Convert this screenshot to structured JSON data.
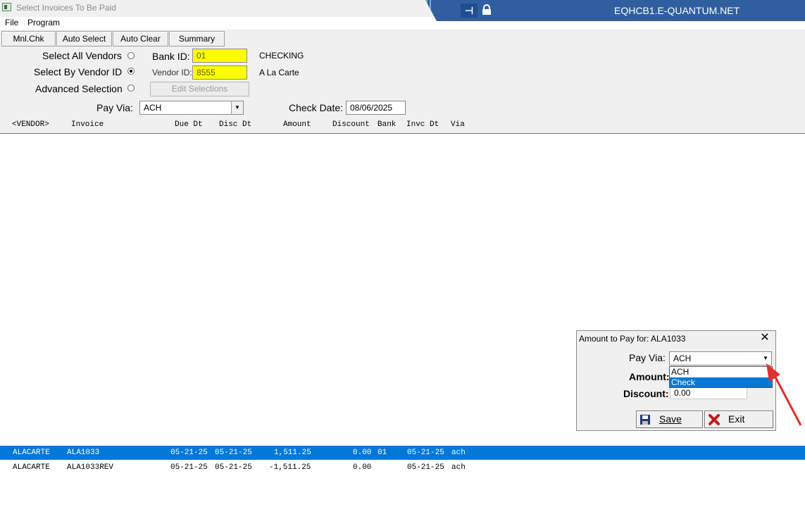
{
  "window": {
    "title": "Select Invoices To Be Paid",
    "server": "EQHCB1.E-QUANTUM.NET",
    "banner_color": "#2f5f9e"
  },
  "menu": {
    "file": "File",
    "program": "Program"
  },
  "toolbar": {
    "manual_check": "Mnl.Chk",
    "auto_select": "Auto Select",
    "auto_clear": "Auto Clear",
    "summary": "Summary"
  },
  "form": {
    "select_all_vendors": "Select All Vendors",
    "select_by_vendor_id": "Select By Vendor ID",
    "advanced_selection": "Advanced Selection",
    "selected_mode": "select_by_vendor_id",
    "bank_id_label": "Bank ID:",
    "bank_id_value": "01",
    "bank_name": "CHECKING",
    "vendor_id_label": "Vendor ID:",
    "vendor_id_value": "8555",
    "vendor_name": "A La Carte",
    "edit_selections": "Edit Selections",
    "pay_via_label": "Pay Via:",
    "pay_via_value": "ACH",
    "check_date_label": "Check Date:",
    "check_date_value": "08/06/2025",
    "field_highlight_color": "#ffff00"
  },
  "columns": {
    "vendor": "<VENDOR>",
    "invoice": "Invoice",
    "due_dt": "Due Dt",
    "disc_dt": "Disc Dt",
    "amount": "Amount",
    "discount": "Discount",
    "bank": "Bank",
    "invc_dt": "Invc Dt",
    "via": "Via"
  },
  "rows": [
    {
      "vendor": "ALACARTE",
      "invoice": "ALA1033",
      "due_dt": "05-21-25",
      "disc_dt": "05-21-25",
      "amount": "1,511.25",
      "discount": "0.00",
      "bank": "01",
      "invc_dt": "05-21-25",
      "via": "ach",
      "selected": true
    },
    {
      "vendor": "ALACARTE",
      "invoice": "ALA1033REV",
      "due_dt": "05-21-25",
      "disc_dt": "05-21-25",
      "amount": "-1,511.25",
      "discount": "0.00",
      "bank": "",
      "invc_dt": "05-21-25",
      "via": "ach",
      "selected": false
    }
  ],
  "dialog": {
    "title": "Amount to Pay for: ALA1033",
    "pay_via_label": "Pay Via:",
    "pay_via_value": "ACH",
    "amount_label": "Amount:",
    "discount_label": "Discount:",
    "discount_value": "0.00",
    "options": [
      "ACH",
      "Check"
    ],
    "highlighted_option": "Check",
    "save": "Save",
    "exit": "Exit"
  },
  "selection_color": "#0078d7",
  "annotation_arrow_color": "#e03030"
}
